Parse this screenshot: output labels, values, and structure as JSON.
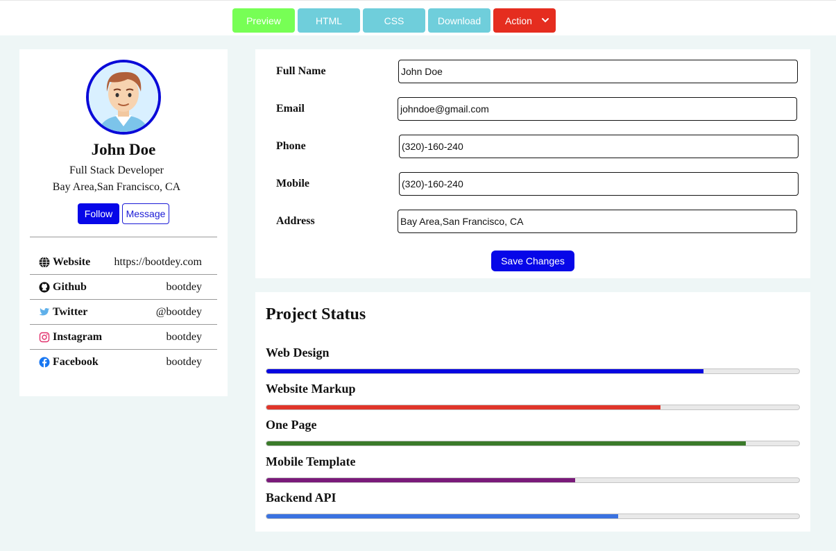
{
  "toolbar": {
    "preview": "Preview",
    "html": "HTML",
    "css": "CSS",
    "download": "Download",
    "action": "Action"
  },
  "profile": {
    "name": "John Doe",
    "role": "Full Stack Developer",
    "location": "Bay Area,San Francisco, CA",
    "follow_label": "Follow",
    "message_label": "Message",
    "links": [
      {
        "icon": "globe-icon",
        "label": "Website",
        "value": "https://bootdey.com"
      },
      {
        "icon": "github-icon",
        "label": "Github",
        "value": "bootdey"
      },
      {
        "icon": "twitter-icon",
        "label": "Twitter",
        "value": "@bootdey"
      },
      {
        "icon": "instagram-icon",
        "label": "Instagram",
        "value": "bootdey"
      },
      {
        "icon": "facebook-icon",
        "label": "Facebook",
        "value": "bootdey"
      }
    ]
  },
  "form": {
    "fields": [
      {
        "label": "Full Name",
        "value": "John Doe"
      },
      {
        "label": "Email",
        "value": "johndoe@gmail.com"
      },
      {
        "label": "Phone",
        "value": "(320)-160-240"
      },
      {
        "label": "Mobile",
        "value": "(320)-160-240"
      },
      {
        "label": "Address",
        "value": "Bay Area,San Francisco, CA"
      }
    ],
    "save_label": "Save Changes"
  },
  "project_status": {
    "title": "Project Status",
    "projects": [
      {
        "name": "Web Design",
        "progress": 0.82,
        "color": "#0707e0"
      },
      {
        "name": "Website Markup",
        "progress": 0.74,
        "color": "#e0352a"
      },
      {
        "name": "One Page",
        "progress": 0.9,
        "color": "#3a7a2a"
      },
      {
        "name": "Mobile Template",
        "progress": 0.58,
        "color": "#7a1a7a"
      },
      {
        "name": "Backend API",
        "progress": 0.66,
        "color": "#3a72e0"
      }
    ]
  },
  "colors": {
    "page_bg": "#eef6f6",
    "primary": "#0707e8",
    "preview": "#77ff55",
    "teal": "#6fcedb",
    "action": "#e52d1f"
  }
}
